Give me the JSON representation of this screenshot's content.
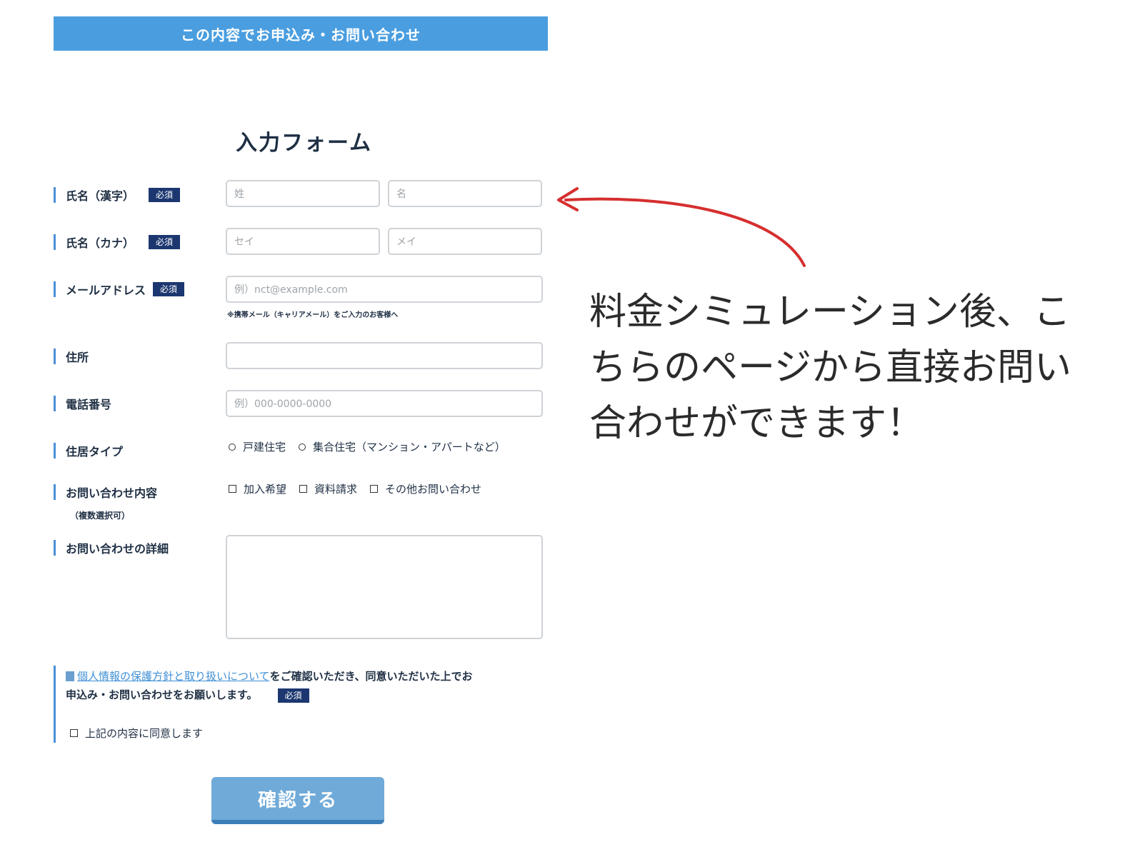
{
  "top_button": {
    "label": "この内容でお申込み・お問い合わせ"
  },
  "form": {
    "title": "入力フォーム",
    "required_badge": "必須",
    "fields": {
      "name_kanji": {
        "label": "氏名（漢字）",
        "placeholder_last": "姓",
        "placeholder_first": "名"
      },
      "name_kana": {
        "label": "氏名（カナ）",
        "placeholder_last": "セイ",
        "placeholder_first": "メイ"
      },
      "email": {
        "label": "メールアドレス",
        "placeholder": "例）nct@example.com",
        "note": "※携帯メール（キャリアメール）をご入力のお客様へ"
      },
      "address": {
        "label": "住所",
        "placeholder": ""
      },
      "phone": {
        "label": "電話番号",
        "placeholder": "例）000-0000-0000"
      },
      "housing_type": {
        "label": "住居タイプ",
        "options": [
          "戸建住宅",
          "集合住宅（マンション・アパートなど）"
        ]
      },
      "inquiry_content": {
        "label": "お問い合わせ内容",
        "sublabel": "（複数選択可）",
        "options": [
          "加入希望",
          "資料請求",
          "その他お問い合わせ"
        ]
      },
      "inquiry_detail": {
        "label": "お問い合わせの詳細"
      }
    },
    "privacy": {
      "link_text": "個人情報の保護方針と取り扱いについて",
      "text_line1_rest": "をご確認いただき、同意いただいた上でお",
      "text_line2": "申込み・お問い合わせをお願いします。",
      "agree_label": "上記の内容に同意します"
    },
    "submit_label": "確認する"
  },
  "annotation": {
    "text": "料金シミュレーション後、こちらのページから直接お問い合わせができます！",
    "arrow_color": "#d62f2f"
  },
  "colors": {
    "accent": "#4a9ee0",
    "required_badge": "#1c3770",
    "submit": "#6faad9"
  }
}
